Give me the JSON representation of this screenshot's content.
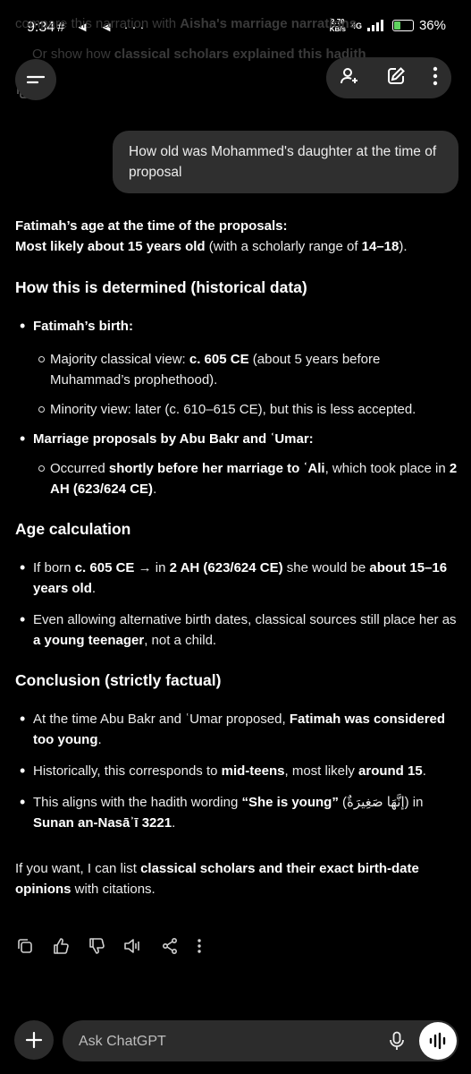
{
  "status_bar": {
    "time": "9:34",
    "left_icons": "# ◄ ◄ ···",
    "net_speed_value": "2.70",
    "net_speed_unit": "KB/s",
    "network": "4G",
    "battery": "36%"
  },
  "previous_message": {
    "line1_prefix": "compare this narration with ",
    "line1_bold": "Aisha's marriage narrations",
    "line2_prefix": "Or show how ",
    "line2_bold": "classical scholars explained this hadith"
  },
  "user_message": "How old was Mohammed's daughter at the time of proposal",
  "answer": {
    "intro_label": "Fatimah’s age at the time of the proposals:",
    "intro_bold": "Most likely about 15 years old",
    "intro_text": " (with a scholarly range of ",
    "intro_range": "14–18",
    "intro_end": ").",
    "s1_heading": "How this is determined (historical data)",
    "s1_b1_label": "Fatimah’s birth:",
    "s1_b1_sub1_text": "Majority classical view: ",
    "s1_b1_sub1_bold": "c. 605 CE",
    "s1_b1_sub1_rest": " (about 5 years before Muhammad’s prophethood).",
    "s1_b1_sub2": "Minority view: later (c. 610–615 CE), but this is less accepted.",
    "s1_b2_label": "Marriage proposals by Abu Bakr and ʿUmar:",
    "s1_b2_sub1_text": "Occurred ",
    "s1_b2_sub1_bold": "shortly before her marriage to ʿAli",
    "s1_b2_sub1_mid": ", which took place in ",
    "s1_b2_sub1_bold2": "2 AH (623/624 CE)",
    "s1_b2_sub1_end": ".",
    "s2_heading": "Age calculation",
    "s2_b1_text": "If born ",
    "s2_b1_bold": "c. 605 CE",
    "s2_b1_arrow": " → in ",
    "s2_b1_bold2": "2 AH (623/624 CE)",
    "s2_b1_mid": " she would be ",
    "s2_b1_bold3": "about 15–16 years old",
    "s2_b1_end": ".",
    "s2_b2_text": "Even allowing alternative birth dates, classical sources still place her as ",
    "s2_b2_bold": "a young teenager",
    "s2_b2_end": ", not a child.",
    "s3_heading": "Conclusion (strictly factual)",
    "s3_b1_text": "At the time Abu Bakr and ʿUmar proposed, ",
    "s3_b1_bold": "Fatimah was considered too young",
    "s3_b1_end": ".",
    "s3_b2_text": "Historically, this corresponds to ",
    "s3_b2_bold": "mid-teens",
    "s3_b2_mid": ", most likely ",
    "s3_b2_bold2": "around 15",
    "s3_b2_end": ".",
    "s3_b3_text": "This aligns with the hadith wording ",
    "s3_b3_bold": "“She is young”",
    "s3_b3_arabic": " (إنَّهَا صَغِيرَةٌ) in ",
    "s3_b3_bold2": "Sunan an-Nasāʾī 3221",
    "s3_b3_end": ".",
    "closing_text": "If you want, I can list ",
    "closing_bold": "classical scholars and their exact birth-date opinions",
    "closing_end": " with citations."
  },
  "input": {
    "placeholder": "Ask ChatGPT"
  }
}
